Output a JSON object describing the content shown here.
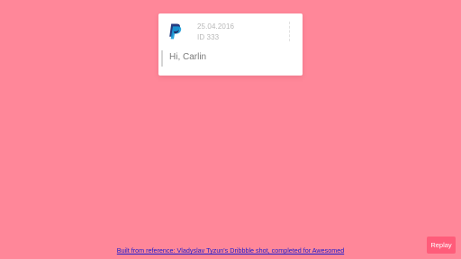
{
  "background_color": "#ff8799",
  "card": {
    "logo_icon": "paypal-logo-icon",
    "date": "25.04.2016",
    "reference": "ID 333",
    "greeting": "Hi, Carlin"
  },
  "footer": {
    "credit_link": "Built from reference: Vladyslav Tyzun's Dribbble shot, completed for Awesomed"
  },
  "actions": {
    "replay_label": "Replay",
    "replay_color": "#ff5c7a"
  }
}
